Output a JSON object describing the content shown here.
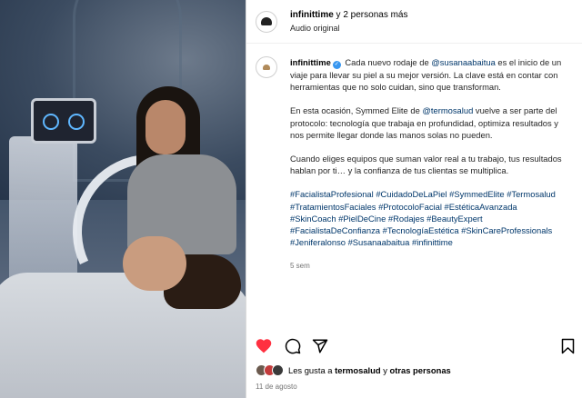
{
  "header": {
    "title_bold": "infinittime",
    "title_rest": " y 2 personas más",
    "subtitle": "Audio original"
  },
  "caption": {
    "username": "infinittime",
    "verified_icon": "verified-badge-icon",
    "p1": [
      {
        "text": "Cada nuevo rodaje de "
      },
      {
        "text": "@susanaabaitua",
        "link": true
      },
      {
        "text": " es el inicio de un viaje para llevar su piel a su mejor versión. La clave está en contar con herramientas que no solo cuidan, sino que transforman."
      }
    ],
    "p2": [
      {
        "text": "En esta ocasión, Symmed Elite de "
      },
      {
        "text": "@termosalud",
        "link": true
      },
      {
        "text": " vuelve a ser parte del protocolo: tecnología que trabaja en profundidad, optimiza resultados y nos permite llegar donde las manos solas no pueden."
      }
    ],
    "p3": "Cuando eliges equipos que suman valor real a tu trabajo, tus resultados hablan por ti… y la confianza de tus clientas se multiplica.",
    "hashtags": [
      "#FacialistaProfesional",
      "#CuidadoDeLaPiel",
      "#SymmedElite",
      "#Termosalud",
      "#TratamientosFaciales",
      "#ProtocoloFacial",
      "#EstéticaAvanzada",
      "#SkinCoach",
      "#PielDeCine",
      "#Rodajes",
      "#BeautyExpert",
      "#FacialistaDeConfianza",
      "#TecnologíaEstética",
      "#SkinCareProfessionals",
      "#Jeniferalonso",
      "#Susanaabaitua",
      "#infinittime"
    ],
    "time": "5 sem"
  },
  "actions": {
    "like_icon": "heart-filled-icon",
    "comment_icon": "comment-icon",
    "share_icon": "share-icon",
    "save_icon": "bookmark-icon",
    "like_color": "#ff3040"
  },
  "likes": {
    "prefix": "Les gusta a ",
    "user": "termosalud",
    "middle": " y ",
    "others": "otras personas"
  },
  "date": "11 de agosto",
  "colors": {
    "link": "#00376b",
    "verified": "#3897f0",
    "muted": "#737373"
  }
}
